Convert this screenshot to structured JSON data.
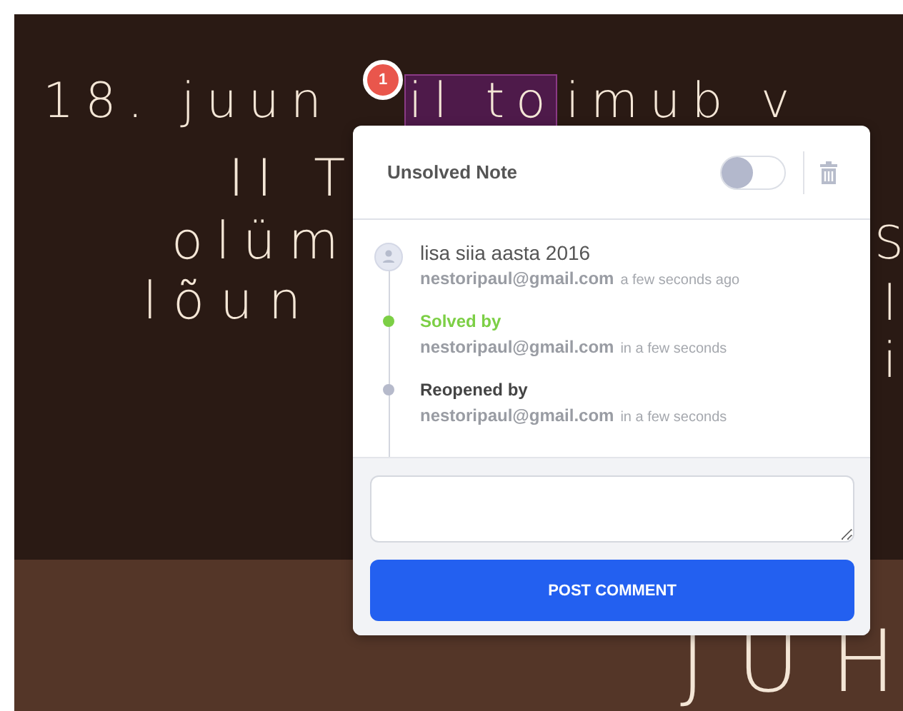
{
  "background_text": [
    {
      "text": "18. juun"
    },
    {
      "text": "il to"
    },
    {
      "text": "imub v"
    },
    {
      "text": "II T"
    },
    {
      "text": "olüm"
    },
    {
      "text": "lõun"
    },
    {
      "text": "S"
    },
    {
      "text": "l"
    },
    {
      "text": "i"
    },
    {
      "text": "JUH"
    }
  ],
  "marker": {
    "count": "1"
  },
  "note": {
    "title": "Unsolved Note",
    "resolved_toggle": {
      "on": false
    },
    "timeline": [
      {
        "kind": "comment",
        "text": "lisa siia aasta 2016",
        "author": "nestoripaul@gmail.com",
        "time": "a few seconds ago"
      },
      {
        "kind": "solved",
        "text": "Solved by",
        "author": "nestoripaul@gmail.com",
        "time": "in a few seconds"
      },
      {
        "kind": "reopened",
        "text": "Reopened by",
        "author": "nestoripaul@gmail.com",
        "time": "in a few seconds"
      }
    ],
    "post_button": "POST COMMENT"
  }
}
